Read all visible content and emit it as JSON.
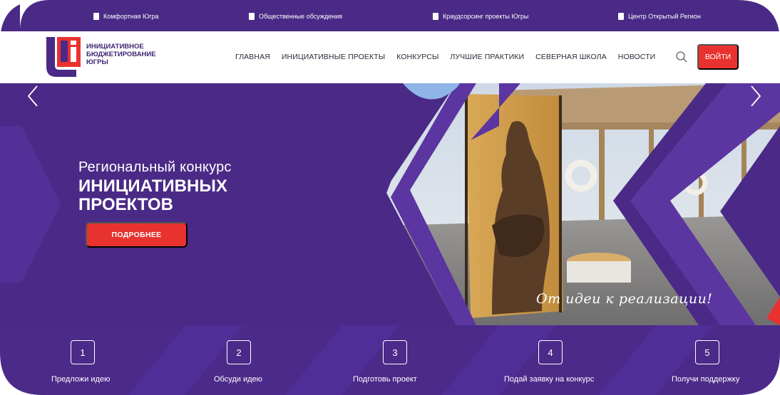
{
  "top_links": [
    {
      "label": "Комфортная Югра",
      "icon": "document-icon"
    },
    {
      "label": "Общественные обсуждения",
      "icon": "document-icon"
    },
    {
      "label": "Краудсорсинг проекты Югры",
      "icon": "document-icon"
    },
    {
      "label": "Центр Открытый Регион",
      "icon": "document-icon"
    }
  ],
  "logo": {
    "line1": "ИНИЦИАТИВНОЕ",
    "line2": "БЮДЖЕТИРОВАНИЕ",
    "line3": "ЮГРЫ"
  },
  "nav": [
    "ГЛАВНАЯ",
    "ИНИЦИАТИВНЫЕ ПРОЕКТЫ",
    "КОНКУРСЫ",
    "ЛУЧШИЕ ПРАКТИКИ",
    "СЕВЕРНАЯ ШКОЛА",
    "НОВОСТИ"
  ],
  "header": {
    "login_label": "ВОЙТИ",
    "search_icon": "search-icon"
  },
  "hero": {
    "subtitle": "Региональный конкурс",
    "title_line1": "ИНИЦИАТИВНЫХ",
    "title_line2": "ПРОЕКТОВ",
    "more_label": "ПОДРОБНЕЕ",
    "slogan": "От идеи к реализации!",
    "prev_icon": "chevron-left-icon",
    "next_icon": "chevron-right-icon"
  },
  "steps": [
    {
      "num": "1",
      "label": "Предложи идею"
    },
    {
      "num": "2",
      "label": "Обсуди идею"
    },
    {
      "num": "3",
      "label": "Подготовь проект"
    },
    {
      "num": "4",
      "label": "Подай заявку на конкурс"
    },
    {
      "num": "5",
      "label": "Получи поддержку"
    }
  ],
  "colors": {
    "brand_purple": "#4a2a86",
    "accent_red": "#e8322f",
    "light_blue": "#8fb4e6"
  }
}
